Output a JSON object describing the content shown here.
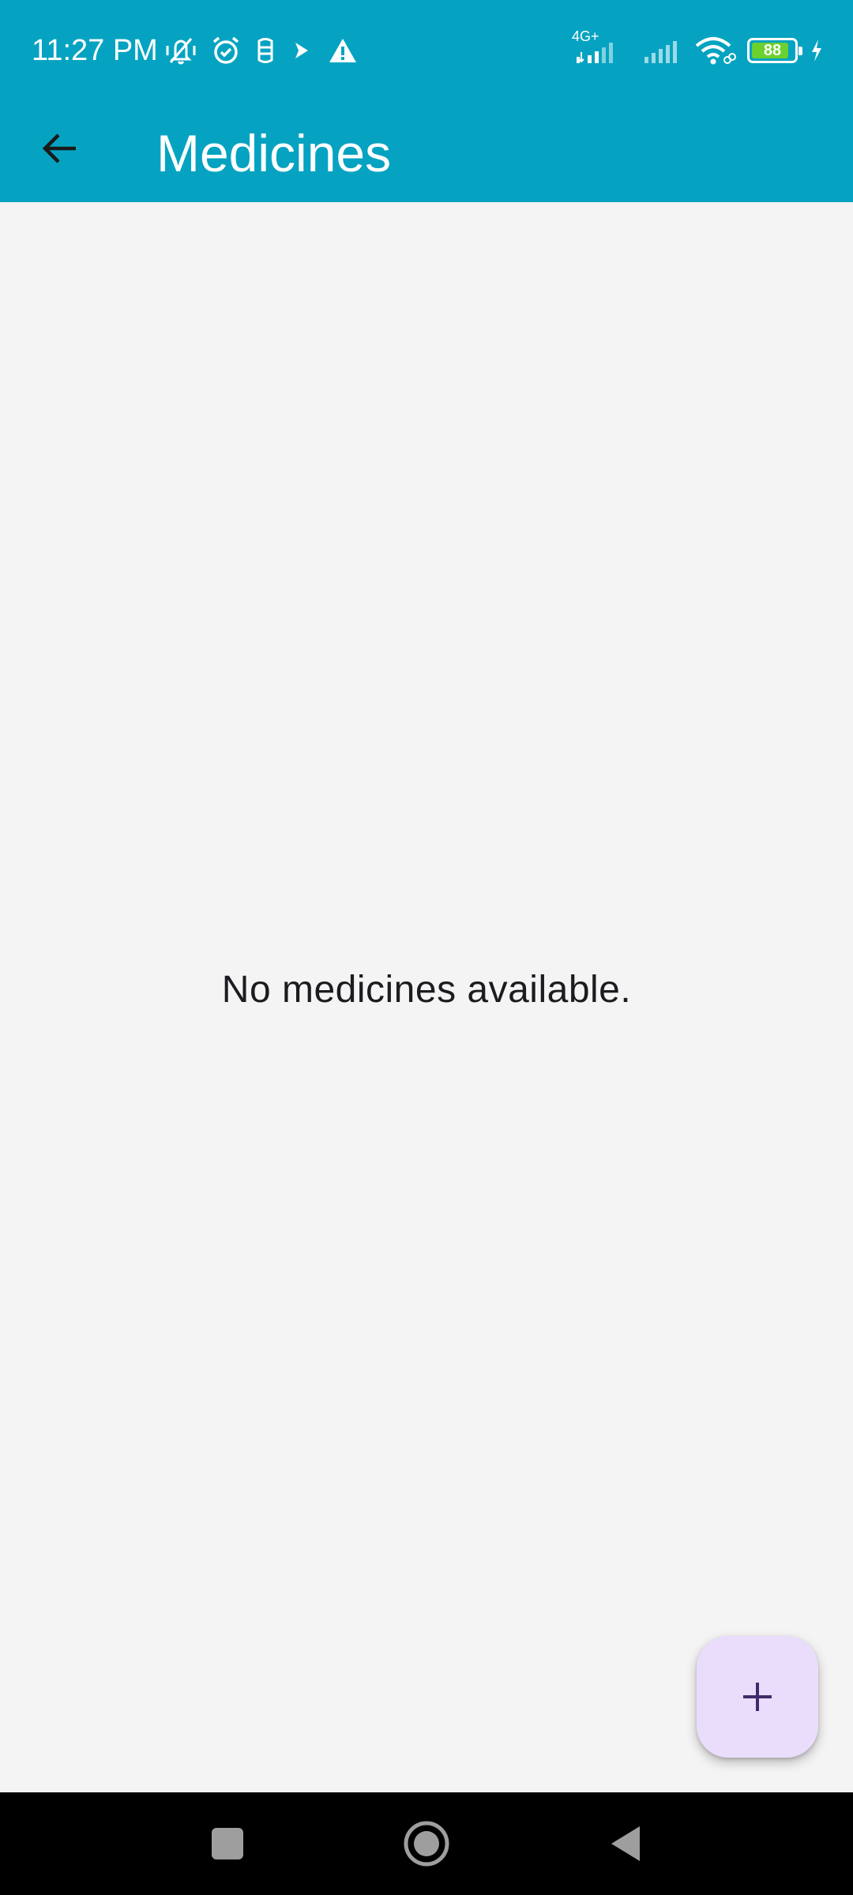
{
  "status_bar": {
    "time": "11:27 PM",
    "network_label": "4G+",
    "battery_level": "88",
    "battery_percent": 88,
    "left_icons": [
      "mute-vibrate-icon",
      "alarm-icon",
      "sim-icon",
      "bluetooth-relay-icon",
      "warning-icon"
    ],
    "right_icons": [
      "signal-4g-icon",
      "signal-icon",
      "wifi-icon",
      "battery-icon",
      "charging-icon"
    ]
  },
  "app_bar": {
    "title": "Medicines",
    "back_icon": "arrow-back-icon",
    "background_color": "#05a3c1"
  },
  "main": {
    "empty_message": "No medicines available."
  },
  "fab": {
    "icon": "plus-icon",
    "background_color": "#eaddfc",
    "icon_color": "#3f2b69"
  },
  "nav_bar": {
    "buttons": [
      "recents-square-icon",
      "home-circle-icon",
      "back-triangle-icon"
    ]
  }
}
